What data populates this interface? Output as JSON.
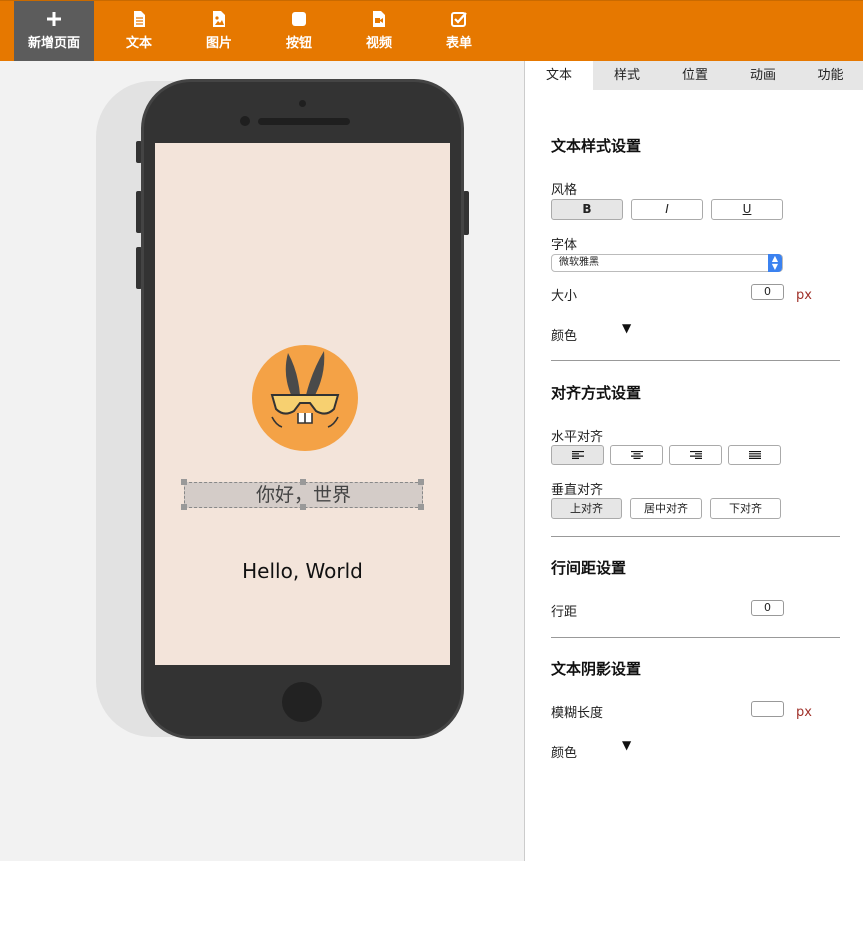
{
  "toolbar": {
    "items": [
      {
        "label": "新增页面",
        "icon": "plus-icon",
        "active": true
      },
      {
        "label": "文本",
        "icon": "document-icon"
      },
      {
        "label": "图片",
        "icon": "image-icon"
      },
      {
        "label": "按钮",
        "icon": "square-icon"
      },
      {
        "label": "视频",
        "icon": "video-icon"
      },
      {
        "label": "表单",
        "icon": "checkbox-icon"
      }
    ]
  },
  "colors": {
    "toolbar": "#e67800",
    "accent_unit": "#a0312a",
    "screen_bg": "#f3e4da",
    "logo": "#f4a246"
  },
  "phone": {
    "selected_text": "你好，世界",
    "hello_text": "Hello, World"
  },
  "panel": {
    "tabs": [
      "文本",
      "样式",
      "位置",
      "动画",
      "功能"
    ],
    "active_tab": "文本",
    "text_style": {
      "title": "文本样式设置",
      "style_label": "风格",
      "style_buttons": [
        "B",
        "I",
        "U"
      ],
      "font_label": "字体",
      "font_value": "微软雅黑",
      "size_label": "大小",
      "size_value": "0",
      "size_unit": "px",
      "color_label": "颜色",
      "color_arrow": "▼"
    },
    "alignment": {
      "title": "对齐方式设置",
      "horizontal_label": "水平对齐",
      "horizontal_options": [
        "align-left-icon",
        "align-center-icon",
        "align-right-icon",
        "align-justify-icon"
      ],
      "vertical_label": "垂直对齐",
      "vertical_options": [
        "上对齐",
        "居中对齐",
        "下对齐"
      ]
    },
    "line_spacing": {
      "title": "行间距设置",
      "label": "行距",
      "value": "0"
    },
    "text_shadow": {
      "title": "文本阴影设置",
      "blur_label": "模糊长度",
      "blur_value": "",
      "blur_unit": "px",
      "color_label": "颜色",
      "color_arrow": "▼"
    }
  }
}
